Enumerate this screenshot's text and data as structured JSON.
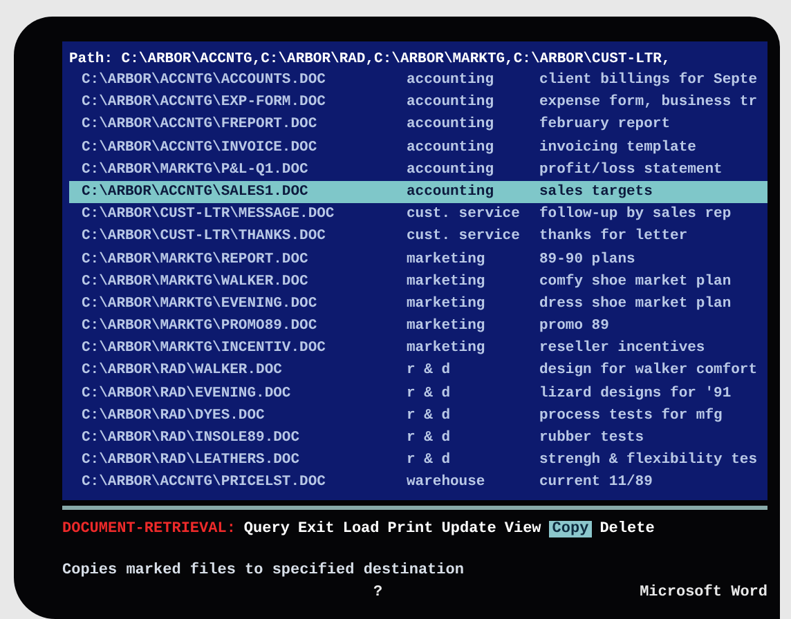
{
  "path_line": "Path: C:\\ARBOR\\ACCNTG,C:\\ARBOR\\RAD,C:\\ARBOR\\MARKTG,C:\\ARBOR\\CUST-LTR,",
  "files": [
    {
      "name": "C:\\ARBOR\\ACCNTG\\ACCOUNTS.DOC",
      "department": "accounting",
      "description": "client billings for Septe",
      "selected": false
    },
    {
      "name": "C:\\ARBOR\\ACCNTG\\EXP-FORM.DOC",
      "department": "accounting",
      "description": "expense form, business tr",
      "selected": false
    },
    {
      "name": "C:\\ARBOR\\ACCNTG\\FREPORT.DOC",
      "department": "accounting",
      "description": "february report",
      "selected": false
    },
    {
      "name": "C:\\ARBOR\\ACCNTG\\INVOICE.DOC",
      "department": "accounting",
      "description": "invoicing template",
      "selected": false
    },
    {
      "name": "C:\\ARBOR\\MARKTG\\P&L-Q1.DOC",
      "department": "accounting",
      "description": "profit/loss statement",
      "selected": false
    },
    {
      "name": "C:\\ARBOR\\ACCNTG\\SALES1.DOC",
      "department": "accounting",
      "description": "sales targets",
      "selected": true
    },
    {
      "name": "C:\\ARBOR\\CUST-LTR\\MESSAGE.DOC",
      "department": "cust. service",
      "description": "follow-up by sales rep",
      "selected": false
    },
    {
      "name": "C:\\ARBOR\\CUST-LTR\\THANKS.DOC",
      "department": "cust. service",
      "description": "thanks for letter",
      "selected": false
    },
    {
      "name": "C:\\ARBOR\\MARKTG\\REPORT.DOC",
      "department": "marketing",
      "description": "89-90 plans",
      "selected": false
    },
    {
      "name": "C:\\ARBOR\\MARKTG\\WALKER.DOC",
      "department": "marketing",
      "description": "comfy shoe market plan",
      "selected": false
    },
    {
      "name": "C:\\ARBOR\\MARKTG\\EVENING.DOC",
      "department": "marketing",
      "description": "dress shoe market plan",
      "selected": false
    },
    {
      "name": "C:\\ARBOR\\MARKTG\\PROMO89.DOC",
      "department": "marketing",
      "description": "promo 89",
      "selected": false
    },
    {
      "name": "C:\\ARBOR\\MARKTG\\INCENTIV.DOC",
      "department": "marketing",
      "description": "reseller incentives",
      "selected": false
    },
    {
      "name": "C:\\ARBOR\\RAD\\WALKER.DOC",
      "department": "r & d",
      "description": "design for walker comfort",
      "selected": false
    },
    {
      "name": "C:\\ARBOR\\RAD\\EVENING.DOC",
      "department": "r & d",
      "description": "lizard designs for '91",
      "selected": false
    },
    {
      "name": "C:\\ARBOR\\RAD\\DYES.DOC",
      "department": "r & d",
      "description": "process tests for mfg",
      "selected": false
    },
    {
      "name": "C:\\ARBOR\\RAD\\INSOLE89.DOC",
      "department": "r & d",
      "description": "rubber tests",
      "selected": false
    },
    {
      "name": "C:\\ARBOR\\RAD\\LEATHERS.DOC",
      "department": "r & d",
      "description": "strengh & flexibility tes",
      "selected": false
    },
    {
      "name": "C:\\ARBOR\\ACCNTG\\PRICELST.DOC",
      "department": "warehouse",
      "description": "current 11/89",
      "selected": false
    }
  ],
  "menu": {
    "title": "DOCUMENT-RETRIEVAL:",
    "items": [
      {
        "label": "Query",
        "selected": false
      },
      {
        "label": "Exit",
        "selected": false
      },
      {
        "label": "Load",
        "selected": false
      },
      {
        "label": "Print",
        "selected": false
      },
      {
        "label": "Update",
        "selected": false
      },
      {
        "label": "View",
        "selected": false
      },
      {
        "label": "Copy",
        "selected": true
      },
      {
        "label": "Delete",
        "selected": false
      }
    ]
  },
  "message": "Copies marked files to specified destination",
  "status": {
    "prompt": "?",
    "app_name": "Microsoft Word"
  }
}
